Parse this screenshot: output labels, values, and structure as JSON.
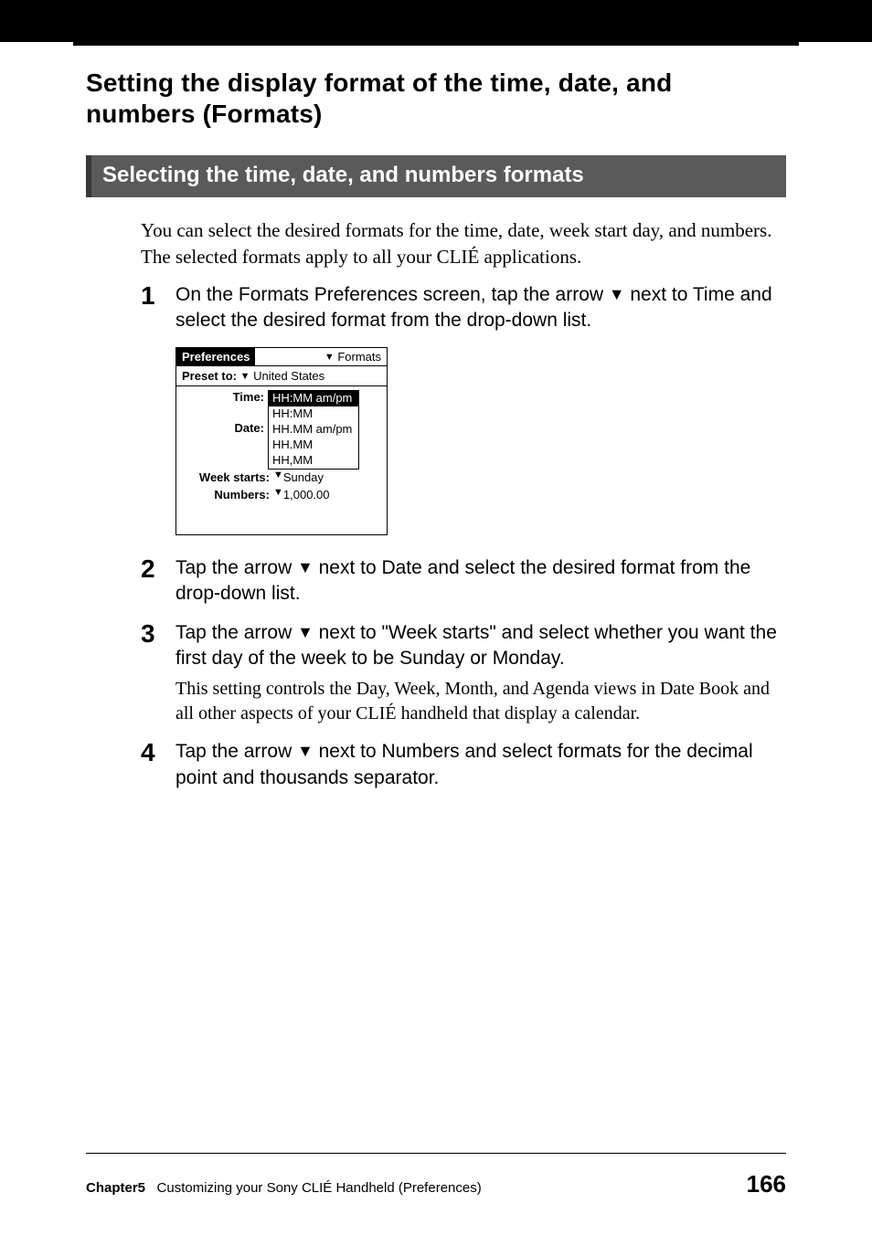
{
  "heading": "Setting the display format of the time, date, and numbers (Formats)",
  "subheading": "Selecting the time, date, and numbers formats",
  "intro": "You can select the desired formats for the time, date, week start day, and numbers. The selected formats apply to all your CLIÉ applications.",
  "steps": {
    "s1": {
      "num": "1",
      "text_a": "On the Formats Preferences screen, tap the arrow ",
      "text_b": " next to Time and select the desired format from the drop-down list."
    },
    "s2": {
      "num": "2",
      "text_a": "Tap the arrow ",
      "text_b": " next to Date and select the desired format from the drop-down list."
    },
    "s3": {
      "num": "3",
      "text_a": "Tap the arrow ",
      "text_b": " next to \"Week starts\" and select whether you want the first day of the week to be Sunday or Monday.",
      "note": "This setting controls the Day, Week, Month, and Agenda views in Date Book and all other aspects of your CLIÉ handheld that display a calendar."
    },
    "s4": {
      "num": "4",
      "text_a": "Tap the arrow ",
      "text_b": " next to Numbers and select formats for the decimal point and thousands separator."
    }
  },
  "pda": {
    "header_left": "Preferences",
    "header_right": "Formats",
    "preset_label": "Preset to:",
    "preset_value": "United States",
    "time_label": "Time:",
    "date_label": "Date:",
    "dropdown": {
      "opt1": "HH:MM am/pm",
      "opt2": "HH:MM",
      "opt3": "HH.MM am/pm",
      "opt4": "HH.MM",
      "opt5": "HH,MM"
    },
    "week_label": "Week starts:",
    "week_value": "Sunday",
    "numbers_label": "Numbers:",
    "numbers_value": "1,000.00"
  },
  "arrow_glyph": "▼",
  "footer": {
    "chapter": "Chapter5",
    "chapter_title": "Customizing your Sony CLIÉ Handheld (Preferences)",
    "page_num": "166"
  }
}
